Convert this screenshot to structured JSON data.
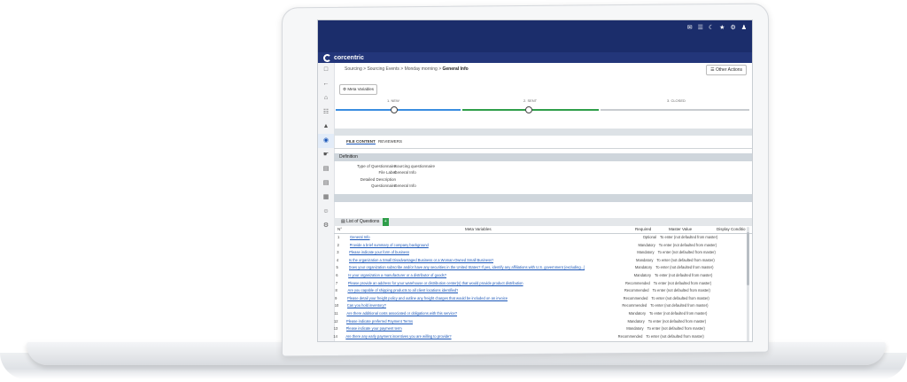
{
  "app": {
    "brand": "corcentric",
    "top_icons": [
      "chat-icon",
      "mail-icon",
      "moon-icon",
      "star-icon",
      "gear-icon",
      "user-icon"
    ]
  },
  "breadcrumb": {
    "items": [
      "Sourcing",
      "Sourcing Events",
      "Monday morning"
    ],
    "current": "General Info",
    "separator": ">"
  },
  "actions": {
    "other_actions": "Other Actions",
    "meta_variables": "Meta Variables"
  },
  "steps": [
    {
      "label": "1. NEW",
      "color": "#3a8de0",
      "done": true
    },
    {
      "label": "2. SENT",
      "color": "#2f9e4a",
      "done": true
    },
    {
      "label": "3. CLOSED",
      "color": "#c8ccd0",
      "done": false
    }
  ],
  "tabs": {
    "file_content": "FILE CONTENT",
    "reviewers": "REVIEWERS"
  },
  "definition": {
    "header": "Definition",
    "rows": [
      {
        "key": "Type of Questionnaire",
        "value": "Sourcing questionnaire"
      },
      {
        "key": "File Label",
        "value": "General Info"
      },
      {
        "key": "Detailed Description",
        "value": ""
      },
      {
        "key": "Questionnaire",
        "value": "General Info"
      }
    ]
  },
  "questions": {
    "header": "List of Questions",
    "columns": {
      "num": "N°",
      "meta": "Meta Variables",
      "required": "Required",
      "master": "Master Value",
      "display": "Display Conditio"
    },
    "rows": [
      {
        "n": "1",
        "q": "General Info",
        "req": "Optional",
        "mv": "To enter (not defaulted from master)"
      },
      {
        "n": "2",
        "q": "Provide a brief summary of company background",
        "req": "Mandatory",
        "mv": "To enter (not defaulted from master)"
      },
      {
        "n": "3",
        "q": "Please indicate your form of business",
        "req": "Mandatory",
        "mv": "To enter (not defaulted from master)"
      },
      {
        "n": "4",
        "q": "Is the organization a Small Disadvantaged Business or a Woman-Owned Small Business?",
        "req": "Mandatory",
        "mv": "To enter (not defaulted from master)"
      },
      {
        "n": "5",
        "q": "Does your organization subscribe and/or have any securities in the United States? If yes, identify any affiliations with U.S. government (excluding...)",
        "req": "Mandatory",
        "mv": "To enter (not defaulted from master)"
      },
      {
        "n": "6",
        "q": "Is your organization a manufacturer or a distributor of goods?",
        "req": "Mandatory",
        "mv": "To enter (not defaulted from master)"
      },
      {
        "n": "7",
        "q": "Please provide an address for your warehouse or distribution center(s) that would provide product distribution",
        "req": "Recommended",
        "mv": "To enter (not defaulted from master)"
      },
      {
        "n": "8",
        "q": "Are you capable of shipping products to all client locations identified?",
        "req": "Recommended",
        "mv": "To enter (not defaulted from master)"
      },
      {
        "n": "9",
        "q": "Please detail your freight policy and outline any freight charges that would be included on an invoice",
        "req": "Recommended",
        "mv": "To enter (not defaulted from master)"
      },
      {
        "n": "10",
        "q": "Can you hold inventory?",
        "req": "Recommended",
        "mv": "To enter (not defaulted from master)"
      },
      {
        "n": "11",
        "q": "Are there additional costs associated or obligations with this service?",
        "req": "Mandatory",
        "mv": "To enter (not defaulted from master)"
      },
      {
        "n": "12",
        "q": "Please indicate preferred Payment Terms",
        "req": "Mandatory",
        "mv": "To enter (not defaulted from master)"
      },
      {
        "n": "13",
        "q": "Please indicate your payment term",
        "req": "Mandatory",
        "mv": "To enter (not defaulted from master)"
      },
      {
        "n": "14",
        "q": "Are there any early payment incentives you are willing to provide?",
        "req": "Recommended",
        "mv": "To enter (not defaulted from master)"
      },
      {
        "n": "15",
        "q": "Please briefly describe your early payment incentives",
        "req": "Recommended",
        "mv": "To enter (not defaulted from master)"
      },
      {
        "n": "16",
        "q": "Safety and Compliance",
        "req": "Optional",
        "mv": "To enter (not defaulted from master)"
      },
      {
        "n": "17",
        "q": "Please detail your quality control measures in order to ensure quality products are delivered to its destination",
        "req": "Mandatory",
        "mv": "To enter (not defaulted from master)"
      },
      {
        "n": "18",
        "q": "Please explain how your company complies with FSMA, DOT and NHTSA standards when sourcing, transporting, and delivering products",
        "req": "Mandatory",
        "mv": "To enter (not defaulted from master)"
      },
      {
        "n": "19",
        "q": "Please upload any relevant security certifications and documentation",
        "req": "Mandatory",
        "mv": "To enter (not defaulted from master)"
      },
      {
        "n": "20",
        "q": "Is the manufacturing plant for the products you sell registered with a government regulatory body such as the FDA or EPA?",
        "req": "Recommended",
        "mv": "Defaulted from master"
      }
    ]
  },
  "colors": {
    "topbar": "#1b2d6b",
    "link": "#1a56b8",
    "section": "#cfd6dc"
  }
}
